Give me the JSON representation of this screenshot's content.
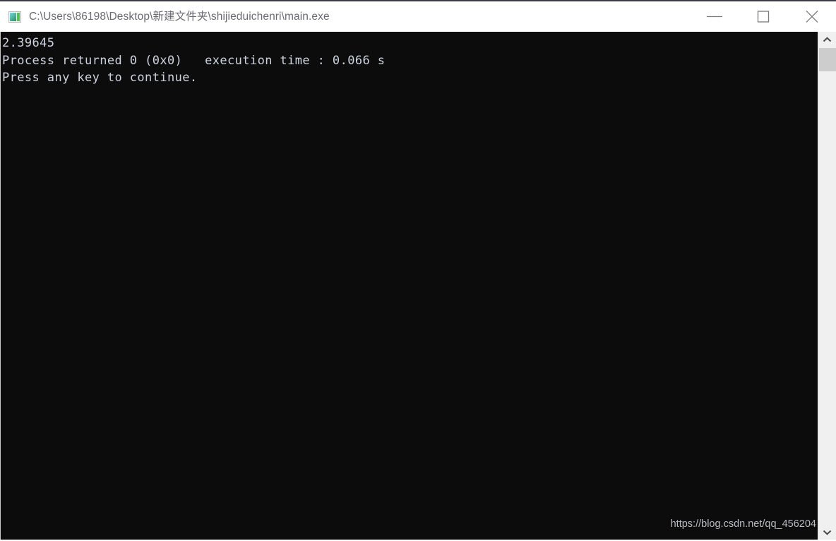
{
  "window": {
    "title": "C:\\Users\\86198\\Desktop\\新建文件夹\\shijieduichenri\\main.exe",
    "icon_name": "console-app-icon",
    "background_color": "#0c0c0c",
    "text_color": "#cdd3de",
    "titlebar_text_color": "#6a6a72"
  },
  "controls": {
    "minimize_label": "Minimize",
    "maximize_label": "Maximize",
    "close_label": "Close"
  },
  "console": {
    "output": "2.39645\nProcess returned 0 (0x0)   execution time : 0.066 s\nPress any key to continue.",
    "lines": [
      "2.39645",
      "Process returned 0 (0x0)   execution time : 0.066 s",
      "Press any key to continue."
    ],
    "result_value": "2.39645",
    "return_code": "0",
    "return_code_hex": "0x0",
    "execution_time": "0.066 s"
  },
  "watermark": {
    "text": "https://blog.csdn.net/qq_456204"
  },
  "scrollbar": {
    "up_arrow": "scroll-up-arrow",
    "down_arrow": "scroll-down-arrow",
    "thumb": "scroll-thumb"
  }
}
